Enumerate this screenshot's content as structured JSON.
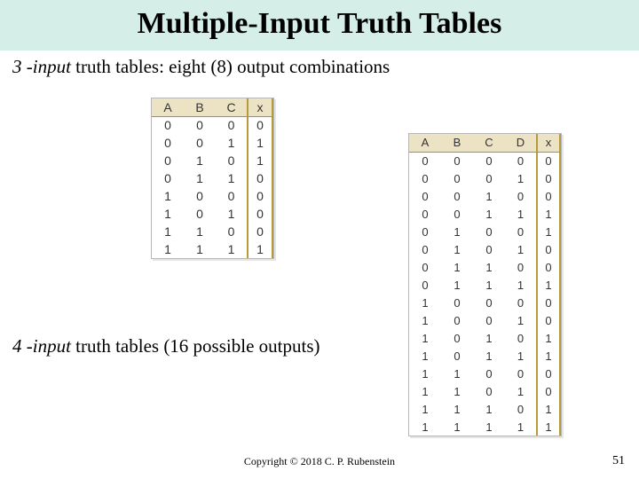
{
  "title": "Multiple-Input Truth Tables",
  "subtitle_lead": "3 -input",
  "subtitle_rest": " truth tables: eight (8) output combinations",
  "subtitle2_lead": "4 -input",
  "subtitle2_rest": " truth tables (16 possible outputs)",
  "copyright": "Copyright © 2018 C. P. Rubenstein",
  "page_number": "51",
  "table3": {
    "headers": [
      "A",
      "B",
      "C",
      "x"
    ],
    "rows": [
      [
        0,
        0,
        0,
        0
      ],
      [
        0,
        0,
        1,
        1
      ],
      [
        0,
        1,
        0,
        1
      ],
      [
        0,
        1,
        1,
        0
      ],
      [
        1,
        0,
        0,
        0
      ],
      [
        1,
        0,
        1,
        0
      ],
      [
        1,
        1,
        0,
        0
      ],
      [
        1,
        1,
        1,
        1
      ]
    ]
  },
  "table4": {
    "headers": [
      "A",
      "B",
      "C",
      "D",
      "x"
    ],
    "rows": [
      [
        0,
        0,
        0,
        0,
        0
      ],
      [
        0,
        0,
        0,
        1,
        0
      ],
      [
        0,
        0,
        1,
        0,
        0
      ],
      [
        0,
        0,
        1,
        1,
        1
      ],
      [
        0,
        1,
        0,
        0,
        1
      ],
      [
        0,
        1,
        0,
        1,
        0
      ],
      [
        0,
        1,
        1,
        0,
        0
      ],
      [
        0,
        1,
        1,
        1,
        1
      ],
      [
        1,
        0,
        0,
        0,
        0
      ],
      [
        1,
        0,
        0,
        1,
        0
      ],
      [
        1,
        0,
        1,
        0,
        1
      ],
      [
        1,
        0,
        1,
        1,
        1
      ],
      [
        1,
        1,
        0,
        0,
        0
      ],
      [
        1,
        1,
        0,
        1,
        0
      ],
      [
        1,
        1,
        1,
        0,
        1
      ],
      [
        1,
        1,
        1,
        1,
        1
      ]
    ]
  }
}
